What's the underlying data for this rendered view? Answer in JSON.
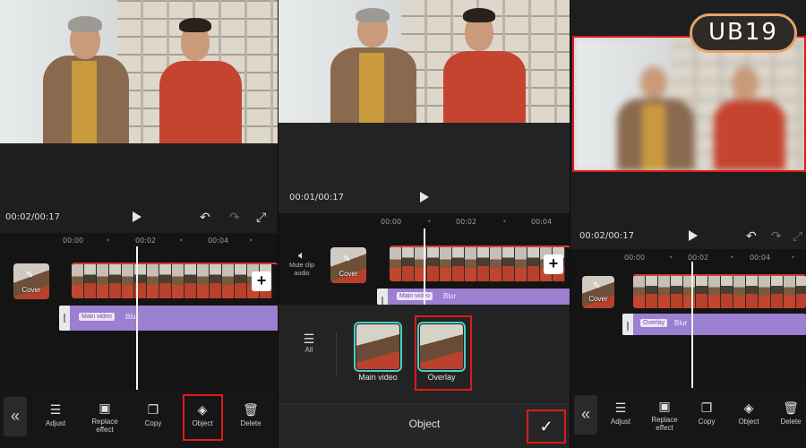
{
  "logo": {
    "text": "UB19"
  },
  "colors": {
    "highlight": "#e0191a",
    "track": "#9b7fd0",
    "accent_outline": "#4ad0c1"
  },
  "panel1": {
    "timecode": "00:02/00:17",
    "ruler": [
      "00:00",
      "00:02",
      "00:04"
    ],
    "cover_label": "Cover",
    "track_tag": "Main video",
    "track_text": "Blur",
    "toolbar": [
      {
        "icon": "sliders-icon",
        "label": "Adjust"
      },
      {
        "icon": "replace-icon",
        "label": "Replace effect"
      },
      {
        "icon": "copy-icon",
        "label": "Copy"
      },
      {
        "icon": "layers-icon",
        "label": "Object"
      },
      {
        "icon": "trash-icon",
        "label": "Delete"
      }
    ]
  },
  "panel2": {
    "timecode": "00:01/00:17",
    "ruler": [
      "00:00",
      "00:02",
      "00:04"
    ],
    "mute_label": "Mute clip audio",
    "cover_label": "Cover",
    "track_tag": "Main video",
    "track_text": "Blur",
    "all_label": "All",
    "options": [
      {
        "label": "Main video"
      },
      {
        "label": "Overlay"
      }
    ],
    "footer_title": "Object"
  },
  "panel3": {
    "timecode": "00:02/00:17",
    "ruler": [
      "00:00",
      "00:02",
      "00:04"
    ],
    "cover_label": "Cover",
    "track_tag": "Overlay",
    "track_text": "Blur",
    "toolbar": [
      {
        "icon": "sliders-icon",
        "label": "Adjust"
      },
      {
        "icon": "replace-icon",
        "label": "Replace effect"
      },
      {
        "icon": "copy-icon",
        "label": "Copy"
      },
      {
        "icon": "layers-icon",
        "label": "Object"
      },
      {
        "icon": "trash-icon",
        "label": "Delete"
      }
    ]
  }
}
